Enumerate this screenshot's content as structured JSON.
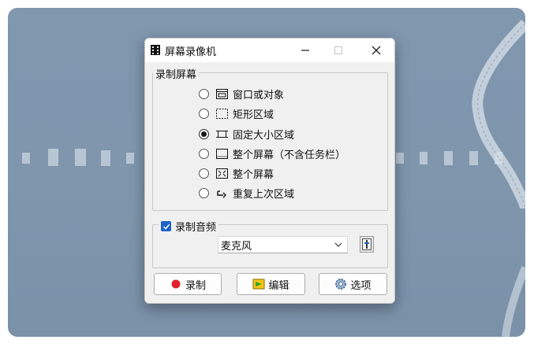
{
  "window": {
    "title": "屏幕录像机",
    "controls": {
      "minimize": "—",
      "maximize": "☐",
      "close": "✕"
    }
  },
  "capture_group": {
    "title": "录制屏幕",
    "selected_index": 2,
    "options": [
      {
        "label": "窗口或对象",
        "icon": "window-object-icon"
      },
      {
        "label": "矩形区域",
        "icon": "rectangle-region-icon"
      },
      {
        "label": "固定大小区域",
        "icon": "fixed-size-region-icon"
      },
      {
        "label": "整个屏幕（不含任务栏）",
        "icon": "fullscreen-no-taskbar-icon"
      },
      {
        "label": "整个屏幕",
        "icon": "fullscreen-icon"
      },
      {
        "label": "重复上次区域",
        "icon": "repeat-last-region-icon"
      }
    ]
  },
  "audio_group": {
    "title": "录制音频",
    "checked": true,
    "device": "麦克风",
    "settings_icon": "audio-settings-icon"
  },
  "buttons": {
    "record": "录制",
    "edit": "编辑",
    "options": "选项"
  },
  "colors": {
    "desktop": "#7f96ad",
    "record_dot": "#e0202a",
    "checkbox": "#1e62c8"
  }
}
